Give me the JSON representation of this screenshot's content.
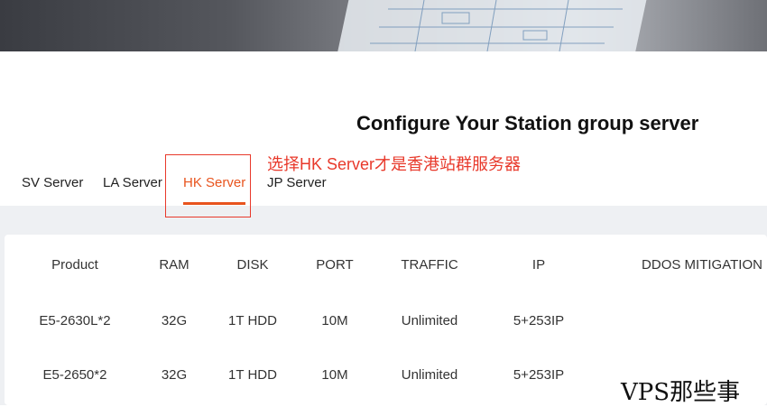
{
  "page": {
    "title": "Configure Your Station group server",
    "note": "选择HK Server才是香港站群服务器"
  },
  "tabs": [
    {
      "label": "SV Server"
    },
    {
      "label": "LA Server"
    },
    {
      "label": "HK Server",
      "active": true
    },
    {
      "label": "JP Server"
    }
  ],
  "table": {
    "headers": [
      "Product",
      "RAM",
      "DISK",
      "PORT",
      "TRAFFIC",
      "IP",
      "DDOS MITIGATION"
    ],
    "rows": [
      [
        "E5-2630L*2",
        "32G",
        "1T HDD",
        "10M",
        "Unlimited",
        "5+253IP",
        ""
      ],
      [
        "E5-2650*2",
        "32G",
        "1T HDD",
        "10M",
        "Unlimited",
        "5+253IP",
        ""
      ]
    ]
  },
  "watermark": "VPS那些事",
  "colors": {
    "accent": "#e8541e",
    "annotation": "#e8392b",
    "band": "#eef0f3"
  }
}
